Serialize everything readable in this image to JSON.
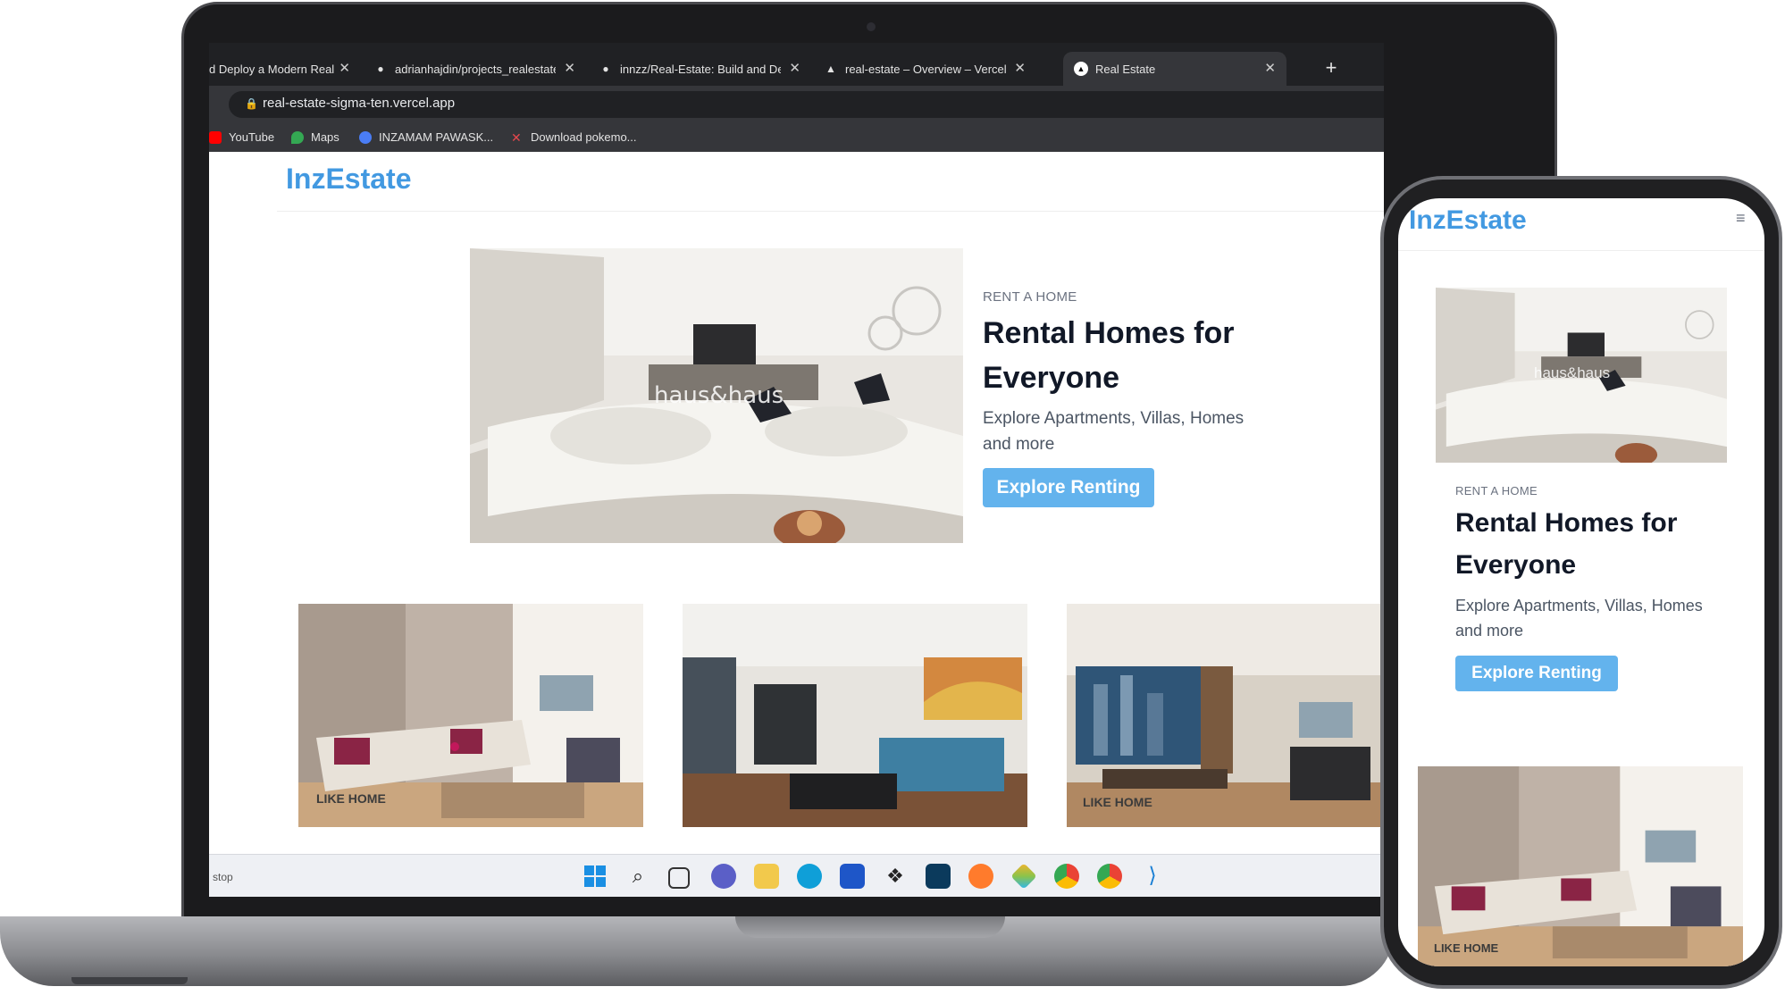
{
  "browser": {
    "tabs": [
      {
        "label": "d Deploy a Modern Real",
        "active": false
      },
      {
        "label": "adrianhajdin/projects_realestate:",
        "active": false
      },
      {
        "label": "innzz/Real-Estate: Build and Depl",
        "active": false
      },
      {
        "label": "real-estate – Overview – Vercel",
        "active": false
      },
      {
        "label": "Real Estate",
        "active": true
      }
    ],
    "new_tab": "+",
    "url": "real-estate-sigma-ten.vercel.app",
    "bookmarks": [
      {
        "label": "YouTube",
        "color": "#ff0000"
      },
      {
        "label": "Maps",
        "color": "#34a853"
      },
      {
        "label": "INZAMAM PAWASK...",
        "color": "#4a7df5"
      },
      {
        "label": "Download pokemo...",
        "color": "#e5484d"
      }
    ]
  },
  "site": {
    "brand": "InzEstate",
    "hero": {
      "tag": "RENT A HOME",
      "title_line1": "Rental Homes for",
      "title_line2": "Everyone",
      "subtitle_line1": "Explore Apartments, Villas, Homes",
      "subtitle_line2": "and more",
      "cta": "Explore Renting",
      "watermark": "haus&haus"
    },
    "cards": [
      {
        "watermark": "LIKE HOME"
      },
      {
        "watermark": ""
      },
      {
        "watermark": "LIKE HOME"
      }
    ]
  },
  "taskbar": {
    "status": "stop"
  },
  "colors": {
    "brand": "#4299e1",
    "cta_bg": "#63b3ed",
    "chrome_dark": "#202124",
    "chrome_mid": "#35363a"
  }
}
